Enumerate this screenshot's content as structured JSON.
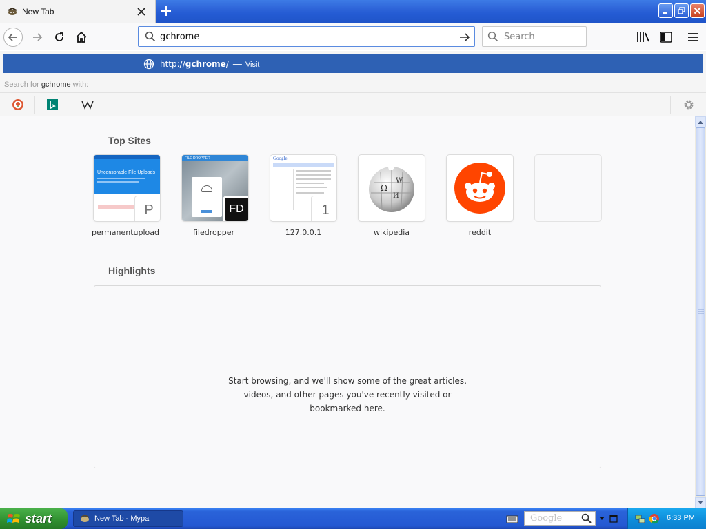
{
  "tab": {
    "title": "New Tab",
    "close_icon": "close-icon",
    "new_tab_icon": "plus-icon"
  },
  "window_controls": {
    "minimize": "minimize-icon",
    "maximize": "restore-icon",
    "close": "close-icon"
  },
  "nav": {
    "url_value": "gchrome",
    "search_placeholder": "Search"
  },
  "popup": {
    "url_prefix": "http://",
    "url_bold": "gchrome",
    "url_suffix": "/",
    "separator": "—",
    "action": "Visit",
    "search_for_prefix": "Search for ",
    "search_for_query": "gchrome",
    "search_for_suffix": " with:",
    "engines": [
      "duckduckgo",
      "bing",
      "wikipedia"
    ]
  },
  "content": {
    "top_sites_title": "Top Sites",
    "highlights_title": "Highlights",
    "highlights_line1": "Start browsing, and we'll show some of the great articles,",
    "highlights_line2": "videos, and other pages you've recently visited or",
    "highlights_line3": "bookmarked here.",
    "top_sites": [
      {
        "label": "permanentupload",
        "badge": "P",
        "headline": "Uncensorable File Uploads"
      },
      {
        "label": "filedropper",
        "badge": "FD",
        "header_text": "FILE DROPPER"
      },
      {
        "label": "127.0.0.1",
        "badge": "1",
        "logo_text": "Google"
      },
      {
        "label": "wikipedia"
      },
      {
        "label": "reddit"
      }
    ]
  },
  "taskbar": {
    "start_label": "start",
    "task_label": "New Tab - Mypal",
    "search_text": "Google",
    "clock": "6:33 PM"
  },
  "colors": {
    "selected_row": "#2e61b4",
    "reddit": "#ff4500",
    "xp_blue": "#245bd3",
    "xp_green": "#2f8f2f"
  }
}
